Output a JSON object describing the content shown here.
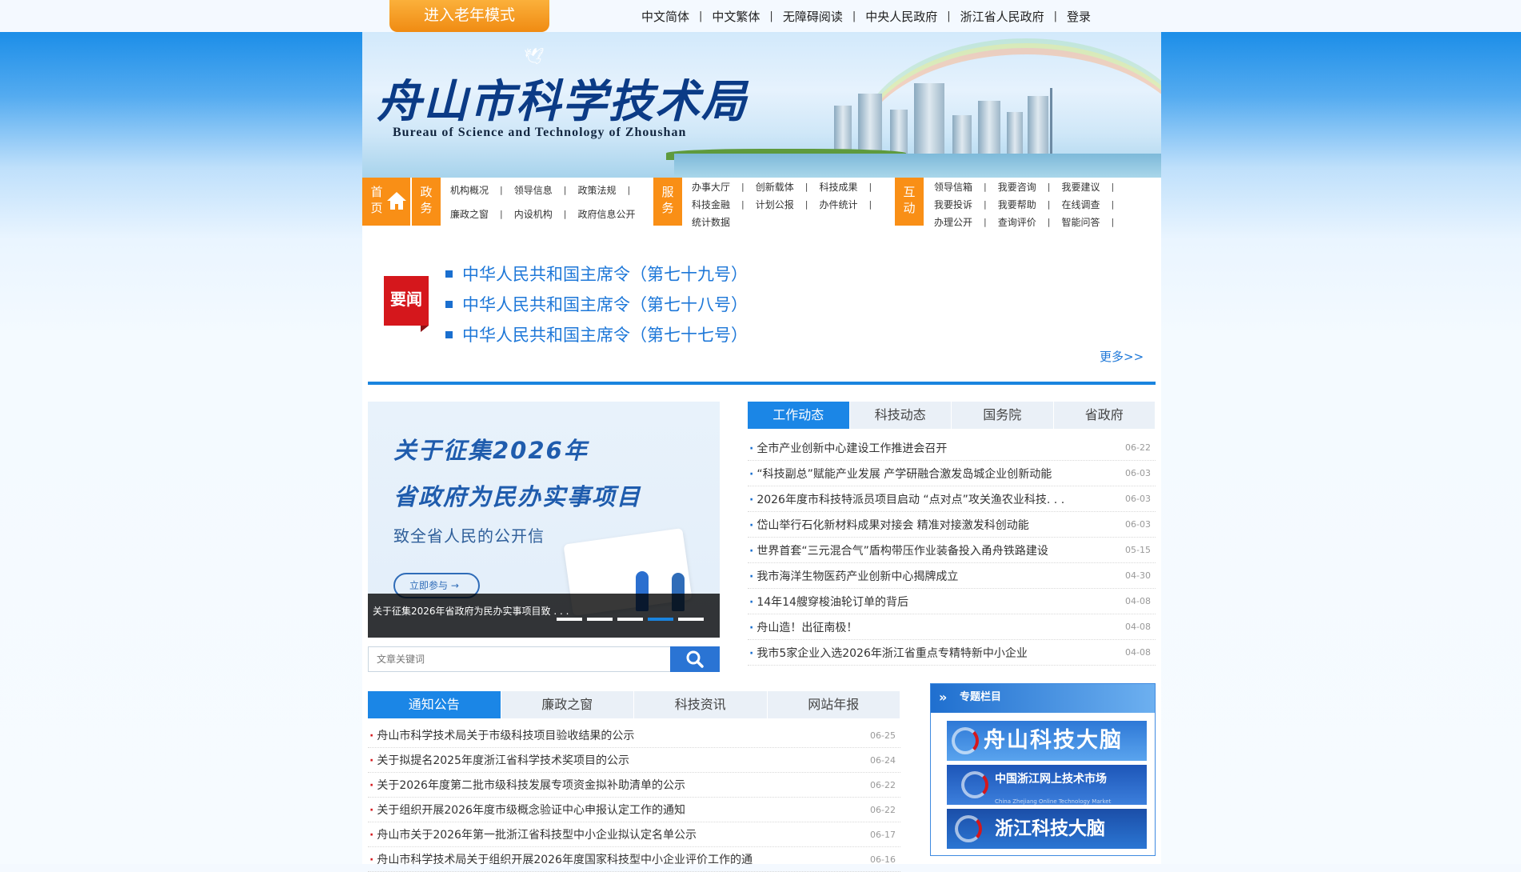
{
  "topbar": {
    "elder_mode": "进入老年模式",
    "links": [
      "中文简体",
      "中文繁体",
      "无障碍阅读",
      "中央人民政府",
      "浙江省人民政府",
      "登录"
    ]
  },
  "banner": {
    "title_cn": "舟山市科学技术局",
    "title_en": "Bureau of Science and Technology of Zhoushan"
  },
  "nav": {
    "home": "首页",
    "zhengwu": "政务",
    "zhengwu_links": [
      [
        "机构概况",
        "领导信息",
        "政策法规"
      ],
      [
        "廉政之窗",
        "内设机构",
        "政府信息公开"
      ]
    ],
    "fuwu": "服务",
    "fuwu_links": [
      [
        "办事大厅",
        "创新载体",
        "科技成果"
      ],
      [
        "科技金融",
        "计划公报",
        "办件统计"
      ],
      [
        "统计数据"
      ]
    ],
    "hudong": "互动",
    "hudong_links": [
      [
        "领导信箱",
        "我要咨询",
        "我要建议"
      ],
      [
        "我要投诉",
        "我要帮助",
        "在线调查"
      ],
      [
        "办理公开",
        "查询评价",
        "智能问答"
      ]
    ]
  },
  "headline": {
    "badge": "要闻",
    "items": [
      "中华人民共和国主席令（第七十九号）",
      "中华人民共和国主席令（第七十八号）",
      "中华人民共和国主席令（第七十七号）"
    ],
    "more": "更多>>"
  },
  "slide": {
    "line1": "关于征集2026年",
    "line2": "省政府为民办实事项目",
    "line3": "致全省人民的公开信",
    "join": "立即参与  →",
    "caption": "关于征集2026年省政府为民办实事项目致 . . ."
  },
  "search": {
    "placeholder": "文章关键词"
  },
  "tabs_right": {
    "tabs": [
      "工作动态",
      "科技动态",
      "国务院",
      "省政府"
    ],
    "items": [
      {
        "title": "全市产业创新中心建设工作推进会召开",
        "date": "06-22"
      },
      {
        "title": "“科技副总”赋能产业发展 产学研融合激发岛城企业创新动能",
        "date": "06-03"
      },
      {
        "title": "2026年度市科技特派员项目启动 “点对点”攻关渔农业科技. . .",
        "date": "06-03"
      },
      {
        "title": "岱山举行石化新材料成果对接会 精准对接激发科创动能",
        "date": "06-03"
      },
      {
        "title": "世界首套“三元混合气”盾构带压作业装备投入甬舟铁路建设",
        "date": "05-15"
      },
      {
        "title": "我市海洋生物医药产业创新中心揭牌成立",
        "date": "04-30"
      },
      {
        "title": "14年14艘穿梭油轮订单的背后",
        "date": "04-08"
      },
      {
        "title": "舟山造！出征南极！",
        "date": "04-08"
      },
      {
        "title": "我市5家企业入选2026年浙江省重点专精特新中小企业",
        "date": "04-08"
      }
    ]
  },
  "tabs_left": {
    "tabs": [
      "通知公告",
      "廉政之窗",
      "科技资讯",
      "网站年报"
    ],
    "items": [
      {
        "title": "舟山市科学技术局关于市级科技项目验收结果的公示",
        "date": "06-25"
      },
      {
        "title": "关于拟提名2025年度浙江省科学技术奖项目的公示",
        "date": "06-24"
      },
      {
        "title": "关于2026年度第二批市级科技发展专项资金拟补助清单的公示",
        "date": "06-22"
      },
      {
        "title": "关于组织开展2026年度市级概念验证中心申报认定工作的通知",
        "date": "06-22"
      },
      {
        "title": "舟山市关于2026年第一批浙江省科技型中小企业拟认定名单公示",
        "date": "06-17"
      },
      {
        "title": "舟山市科学技术局关于组织开展2026年度国家科技型中小企业评价工作的通",
        "date": "06-16"
      }
    ]
  },
  "special": {
    "title": "专题栏目",
    "b1": "舟山科技大脑",
    "b2": "中国浙江网上技术市场",
    "b2_sub": "China Zhejiang Online Technology Market",
    "b3": "浙江科技大脑"
  },
  "colors": {
    "accent": "#1b86e6",
    "orange": "#f98f16",
    "red": "#d5171c"
  }
}
